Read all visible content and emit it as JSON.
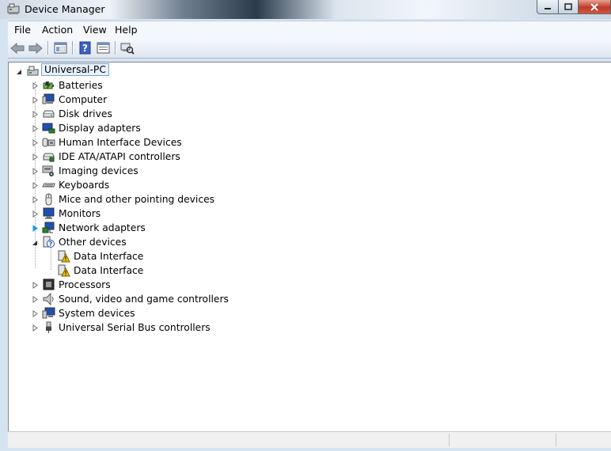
{
  "window": {
    "title": "Device Manager"
  },
  "menu": [
    {
      "id": "file",
      "label": "File"
    },
    {
      "id": "action",
      "label": "Action"
    },
    {
      "id": "view",
      "label": "View"
    },
    {
      "id": "help",
      "label": "Help"
    }
  ],
  "toolbar": {
    "buttons": [
      "back-arrow-icon",
      "forward-arrow-icon",
      "show-hide-console-tree-icon",
      "help-icon",
      "properties-icon",
      "scan-hardware-changes-icon"
    ]
  },
  "tree": {
    "root": "Universal-PC",
    "categories": [
      {
        "label": "Batteries",
        "icon": "battery-icon"
      },
      {
        "label": "Computer",
        "icon": "computer-icon"
      },
      {
        "label": "Disk drives",
        "icon": "disk-drive-icon"
      },
      {
        "label": "Display adapters",
        "icon": "display-adapter-icon"
      },
      {
        "label": "Human Interface Devices",
        "icon": "hid-icon"
      },
      {
        "label": "IDE ATA/ATAPI controllers",
        "icon": "ide-controller-icon"
      },
      {
        "label": "Imaging devices",
        "icon": "camera-icon"
      },
      {
        "label": "Keyboards",
        "icon": "keyboard-icon"
      },
      {
        "label": "Mice and other pointing devices",
        "icon": "mouse-icon"
      },
      {
        "label": "Monitors",
        "icon": "monitor-icon"
      },
      {
        "label": "Network adapters",
        "icon": "network-adapter-icon"
      },
      {
        "label": "Other devices",
        "icon": "unknown-device-icon",
        "expanded": true,
        "children": [
          {
            "label": "Data Interface",
            "icon": "warning-device-icon"
          },
          {
            "label": "Data Interface",
            "icon": "warning-device-icon"
          }
        ]
      },
      {
        "label": "Processors",
        "icon": "processor-icon"
      },
      {
        "label": "Sound, video and game controllers",
        "icon": "speaker-icon"
      },
      {
        "label": "System devices",
        "icon": "system-device-icon"
      },
      {
        "label": "Universal Serial Bus controllers",
        "icon": "usb-icon"
      }
    ]
  },
  "colors": {
    "selection_border": "#7da2ce",
    "expander_active": "#1e9be6",
    "warning": "#f2c200"
  }
}
